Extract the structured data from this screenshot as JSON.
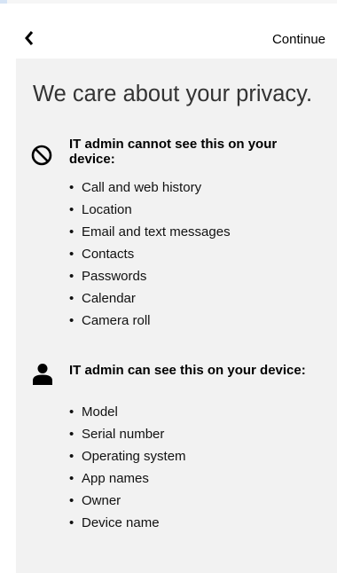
{
  "header": {
    "back_icon": "chevron-left-icon",
    "continue_label": "Continue"
  },
  "title": "We care about your privacy.",
  "cannot_see": {
    "icon": "prohibited-icon",
    "heading": "IT admin cannot see this on your device:",
    "items": [
      "Call and web history",
      "Location",
      "Email and text messages",
      "Contacts",
      "Passwords",
      "Calendar",
      "Camera roll"
    ]
  },
  "can_see": {
    "icon": "person-icon",
    "heading": "IT admin can see this on your device:",
    "items": [
      "Model",
      "Serial number",
      "Operating system",
      "App names",
      "Owner",
      "Device name"
    ]
  }
}
